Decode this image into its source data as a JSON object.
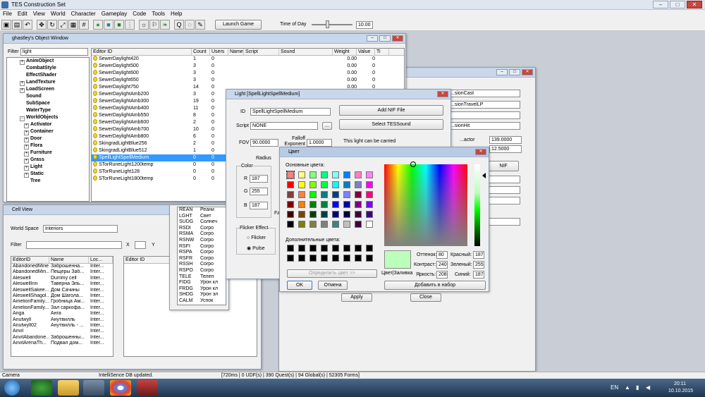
{
  "app": {
    "title": "TES Construction Set"
  },
  "menu": [
    "File",
    "Edit",
    "View",
    "World",
    "Character",
    "Gameplay",
    "Code",
    "Tools",
    "Help"
  ],
  "toolbar": {
    "launch": "Launch Game",
    "time_label": "Time of Day",
    "time_value": "10.00"
  },
  "object_window": {
    "title": "ghastley's Object Window",
    "filter_label": "Filter",
    "filter_value": "light",
    "tree": [
      {
        "label": "AnimObject",
        "pm": "+"
      },
      {
        "label": "CombatStyle",
        "pm": ""
      },
      {
        "label": "EffectShader",
        "pm": ""
      },
      {
        "label": "LandTexture",
        "pm": "+"
      },
      {
        "label": "LoadScreen",
        "pm": "+"
      },
      {
        "label": "Sound",
        "pm": ""
      },
      {
        "label": "SubSpace",
        "pm": ""
      },
      {
        "label": "WaterType",
        "pm": ""
      },
      {
        "label": "WorldObjects",
        "pm": "-"
      },
      {
        "label": "Activator",
        "pm": "+"
      },
      {
        "label": "Container",
        "pm": "+"
      },
      {
        "label": "Door",
        "pm": "+"
      },
      {
        "label": "Flora",
        "pm": "+"
      },
      {
        "label": "Furniture",
        "pm": "+"
      },
      {
        "label": "Grass",
        "pm": "+"
      },
      {
        "label": "Light",
        "pm": "+"
      },
      {
        "label": "Static",
        "pm": "+"
      },
      {
        "label": "Tree",
        "pm": ""
      }
    ],
    "columns": [
      "Editor ID",
      "Count",
      "Users",
      "Name",
      "Script",
      "Sound",
      "Weight",
      "Value",
      "Ti"
    ],
    "rows": [
      [
        "SewerDaylight420",
        "1",
        "0",
        "0.00",
        "0"
      ],
      [
        "SewerDaylight500",
        "3",
        "0",
        "0.00",
        "0"
      ],
      [
        "SewerDaylight600",
        "3",
        "0",
        "0.00",
        "0"
      ],
      [
        "SewerDaylight650",
        "3",
        "0",
        "0.00",
        "0"
      ],
      [
        "SewerDaylight750",
        "14",
        "0",
        "0.00",
        "0"
      ],
      [
        "SewerDaylightAmb200",
        "3",
        "0",
        "0.00",
        "0"
      ],
      [
        "SewerDaylightAmb300",
        "19",
        "0",
        "0.00",
        "0"
      ],
      [
        "SewerDaylightAmb400",
        "11",
        "0",
        "0.00",
        "0"
      ],
      [
        "SewerDaylightAmb550",
        "8",
        "0",
        "0.00",
        "0"
      ],
      [
        "SewerDaylightAmb600",
        "2",
        "0",
        "0.00",
        "0"
      ],
      [
        "SewerDaylightAmb700",
        "10",
        "0",
        "0.00",
        "0"
      ],
      [
        "SewerDaylightAmb800",
        "6",
        "0",
        "0.00",
        "0"
      ],
      [
        "SkingradLightBlue256",
        "2",
        "0",
        "0.00",
        "0"
      ],
      [
        "SkingradLightBlue512",
        "1",
        "0",
        "0.00",
        "0"
      ],
      [
        "SpellLightSpellMedium",
        "0",
        "0",
        "0.00",
        "0"
      ],
      [
        "STorRuneLight1200temp",
        "0",
        "0",
        "0.00",
        "0"
      ],
      [
        "STorRuneLight128",
        "0",
        "0",
        "0.00",
        "0"
      ],
      [
        "STorRuneLight1800temp",
        "0",
        "0",
        "0.00",
        "0"
      ]
    ],
    "selected_index": 14
  },
  "cell_view": {
    "title": "Cell View",
    "worldspace_label": "World Space",
    "worldspace_value": "Interiors",
    "filter_label": "Filter",
    "x_label": "X",
    "y_label": "Y",
    "columns": [
      "EditorID",
      "Name",
      "Loc..."
    ],
    "right_column": "Editor ID",
    "rows": [
      [
        "AbandonedMine",
        "Заброшенна...",
        "Inter..."
      ],
      [
        "AbandonedMin...",
        "Пещеры Заб...",
        "Inter..."
      ],
      [
        "Aleswell",
        "Dummy cell",
        "Inter..."
      ],
      [
        "AleswellInn",
        "Таверна Эль...",
        "Inter..."
      ],
      [
        "AleswellSakee...",
        "Дом Сачины",
        "Inter..."
      ],
      [
        "AleswellShagol...",
        "Дом Шагола...",
        "Inter..."
      ],
      [
        "AmelionFamily...",
        "Гробница Ам...",
        "Inter..."
      ],
      [
        "AmelionFamily...",
        "Зал саркофа...",
        "Inter..."
      ],
      [
        "Anga",
        "Анга",
        "Inter..."
      ],
      [
        "Anutwyll",
        "Анутвилль",
        "Inter..."
      ],
      [
        "Anutwyll02",
        "Анутвилль - ...",
        "Inter..."
      ],
      [
        "Anvil",
        "",
        "Inter..."
      ],
      [
        "AnvilAbandone...",
        "Заброшенны...",
        "Inter..."
      ],
      [
        "AnvilArenaTh...",
        "Подвал дом...",
        "Inter..."
      ]
    ]
  },
  "light_dialog": {
    "title": "Light [SpellLightSpellMedium]",
    "id_label": "ID",
    "id_value": "SpellLightSpellMedium",
    "script_label": "Script",
    "script_value": "NONE",
    "add_nif": "Add NIF File",
    "select_sound": "Select TESSound",
    "fov_label": "FOV",
    "fov_value": "90.0000",
    "falloff_label": "Falloff Exponent",
    "falloff_value": "1.0000",
    "carried_label": "This light can be carried",
    "radius_label": "Radius",
    "color_label": "Color",
    "r_label": "R",
    "r_value": "187",
    "g_label": "G",
    "g_value": "255",
    "b_label": "B",
    "b_value": "187",
    "flicker_label": "Flicker Effect",
    "flicker_opt": "Flicker",
    "pulse_opt": "Pulse",
    "fa_label": "Fa"
  },
  "list_panel": {
    "rows": [
      [
        "REAN",
        "Реани"
      ],
      [
        "LGHT",
        "Свет"
      ],
      [
        "SUDG",
        "Солнеч"
      ],
      [
        "RSDI",
        "Corpo"
      ],
      [
        "RSMA",
        "Corpo"
      ],
      [
        "RSNW",
        "Corpo"
      ],
      [
        "RSFI",
        "Corpo"
      ],
      [
        "RSPA",
        "Corpo"
      ],
      [
        "RSFR",
        "Corpo"
      ],
      [
        "RSSH",
        "Corpo"
      ],
      [
        "RSPO",
        "Corpo"
      ],
      [
        "TELE",
        "Телеп"
      ],
      [
        "FIDG",
        "Урон кл"
      ],
      [
        "FRDG",
        "Урон кл"
      ],
      [
        "SHDG",
        "Урон эл"
      ],
      [
        "CALM",
        "Успок"
      ]
    ]
  },
  "back_window": {
    "dd1": "...sionCast",
    "dd2": "...sionTravelLP",
    "dd4": "...sionHit",
    "f1_label": "...actor",
    "f1": "139.0000",
    "f2": "12.5000",
    "nif_label": "NIF",
    "apply": "Apply",
    "close": "Close"
  },
  "color_dialog": {
    "title": "Цвет",
    "basic_label": "Основные цвета:",
    "custom_label": "Дополнительные цвета:",
    "define": "Определить цвет >>",
    "ok": "OK",
    "cancel": "Отмена",
    "add": "Добавить в набор",
    "hue_label": "Оттенок:",
    "hue": "80",
    "sat_label": "Контраст:",
    "sat": "240",
    "lum_label": "Яркость:",
    "lum": "208",
    "red_label": "Красный:",
    "red": "187",
    "green_label": "Зеленый:",
    "green": "255",
    "blue_label": "Синий:",
    "blue": "187",
    "solid_label": "Цвет|Заливка",
    "selected_color": "#bbffbb",
    "basic_colors": [
      "#ff8080",
      "#ffff80",
      "#80ff80",
      "#00ff80",
      "#80ffff",
      "#0080ff",
      "#ff80c0",
      "#ff80ff",
      "#ff0000",
      "#ffff00",
      "#80ff00",
      "#00ff40",
      "#00ffff",
      "#0080c0",
      "#8080c0",
      "#ff00ff",
      "#804040",
      "#ff8040",
      "#00ff00",
      "#008080",
      "#004080",
      "#8080ff",
      "#800040",
      "#ff0080",
      "#800000",
      "#ff8000",
      "#008000",
      "#008040",
      "#0000ff",
      "#0000a0",
      "#800080",
      "#8000ff",
      "#400000",
      "#804000",
      "#004000",
      "#004040",
      "#000080",
      "#000040",
      "#400040",
      "#400080",
      "#000000",
      "#808000",
      "#808040",
      "#808080",
      "#408080",
      "#c0c0c0",
      "#400040",
      "#ffffff"
    ]
  },
  "status": {
    "camera": "Camera",
    "msg": "IntelliSence DB updated.",
    "stats": "[720ms | 0 UDF(s) | 390 Quest(s) | 94 Global(s) | 52305 Forms]"
  },
  "taskbar": {
    "lang": "EN",
    "time": "20:11",
    "date": "10.10.2015"
  }
}
